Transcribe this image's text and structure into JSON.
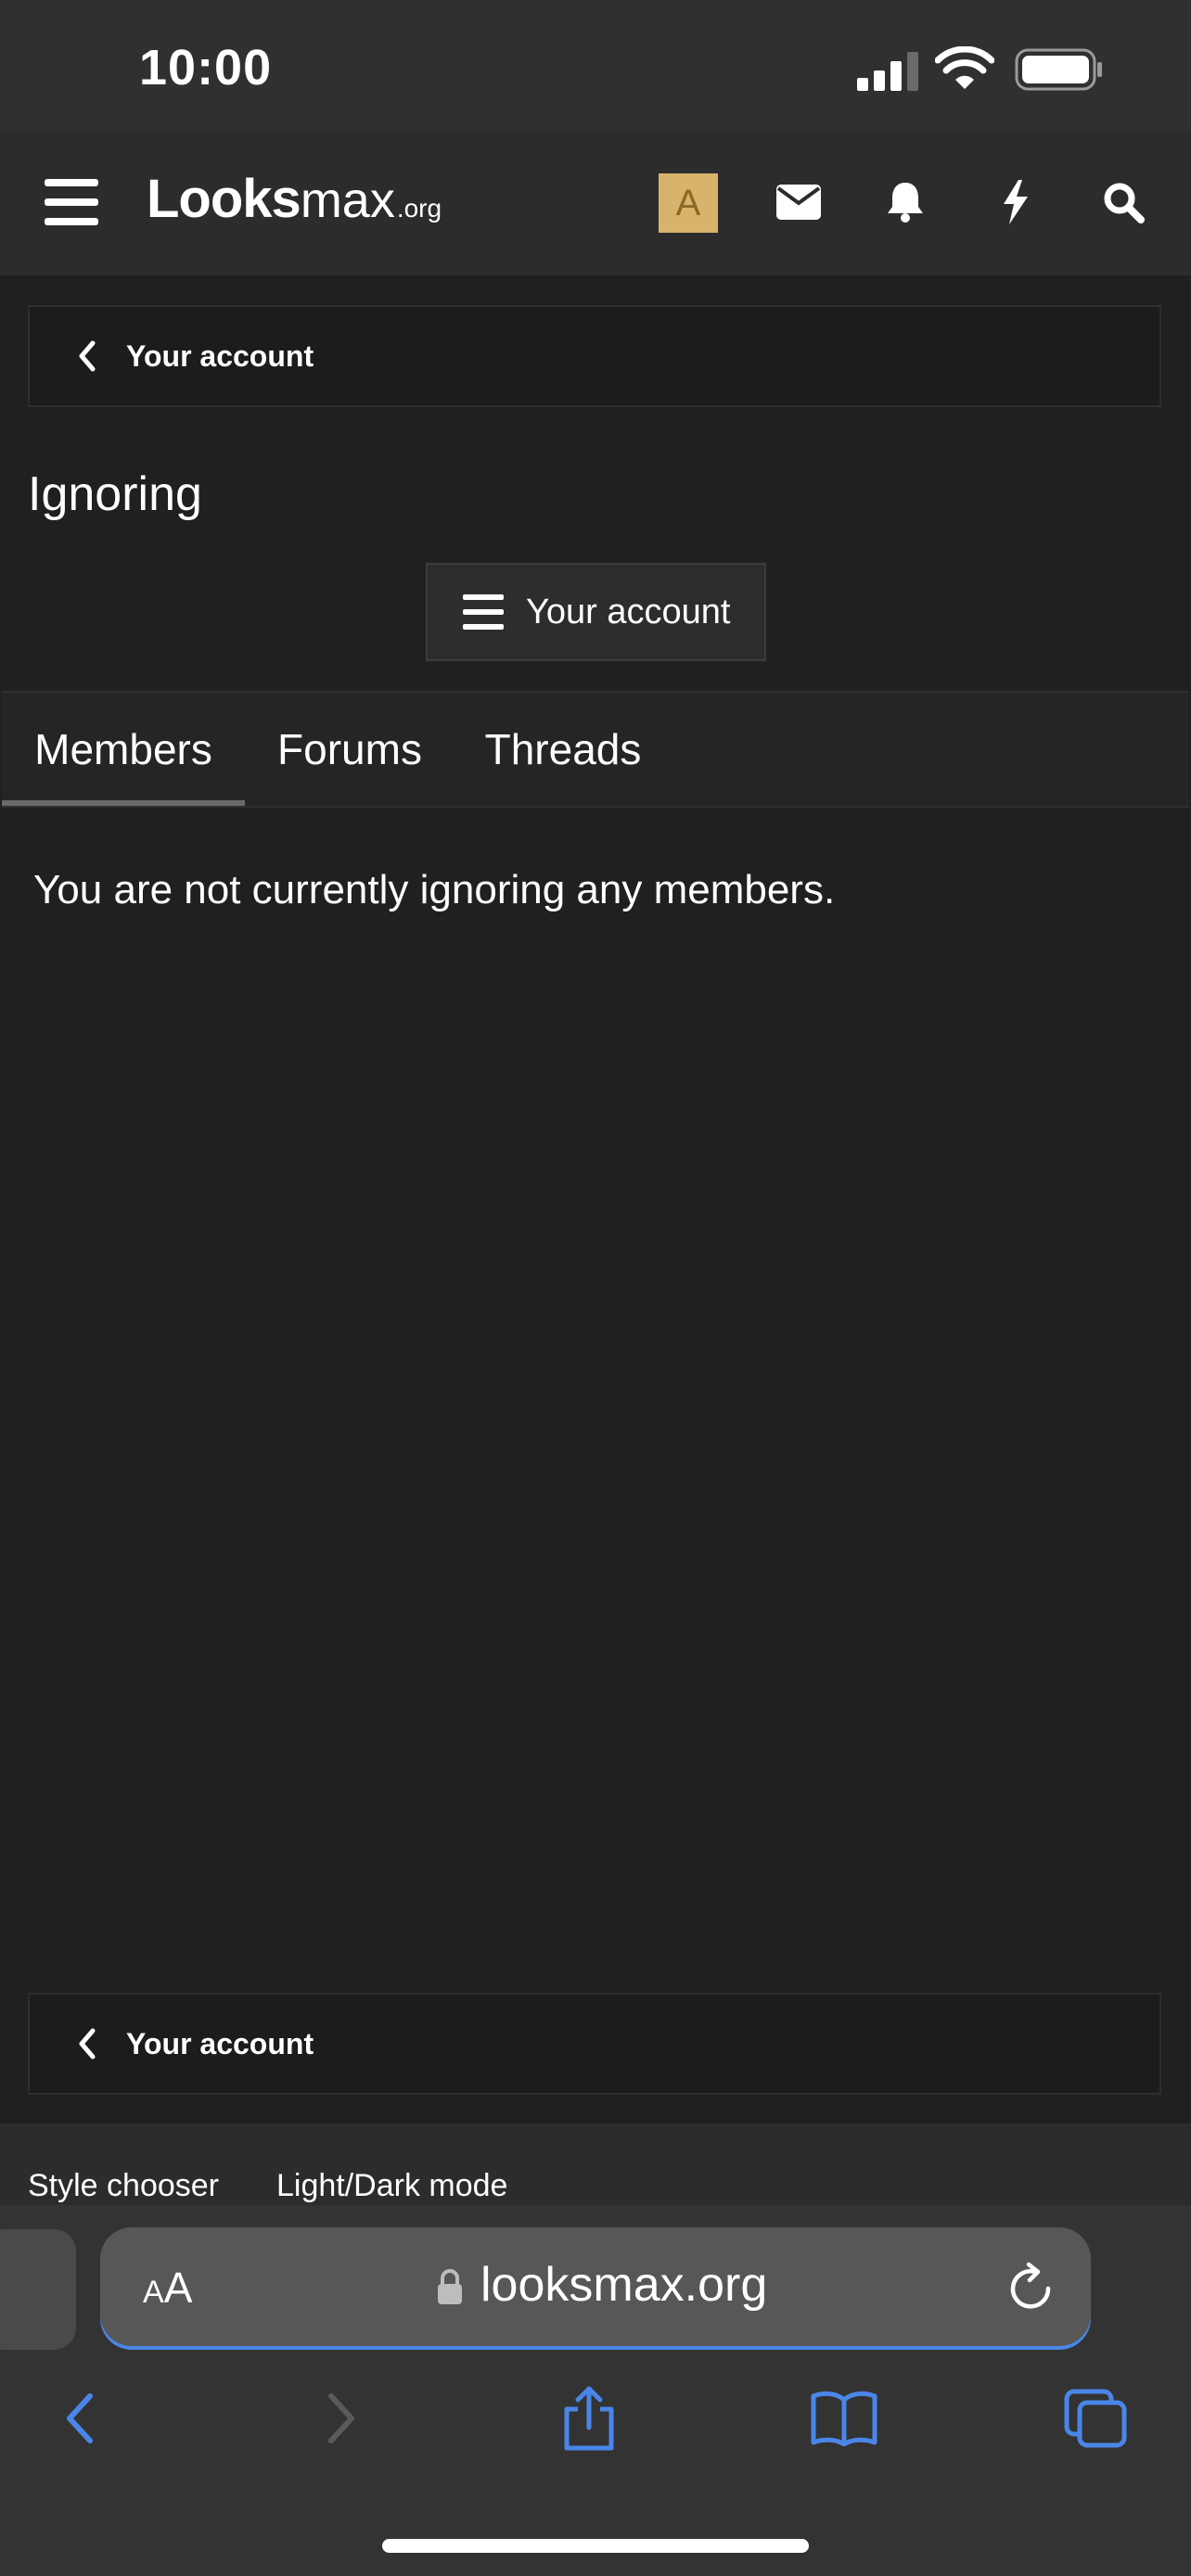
{
  "status_bar": {
    "time": "10:00"
  },
  "navbar": {
    "logo_main": "Looks",
    "logo_max": "max",
    "logo_tld": ".org",
    "avatar_letter": "A"
  },
  "breadcrumb": {
    "label": "Your account"
  },
  "page": {
    "title": "Ignoring",
    "account_menu_label": "Your account"
  },
  "tabs": [
    {
      "label": "Members",
      "active": true
    },
    {
      "label": "Forums",
      "active": false
    },
    {
      "label": "Threads",
      "active": false
    }
  ],
  "empty_message": "You are not currently ignoring any members.",
  "footer": {
    "style_chooser": "Style chooser",
    "light_dark_mode": "Light/Dark mode"
  },
  "browser": {
    "aa_label_small": "A",
    "aa_label_large": "A",
    "url": "looksmax.org"
  },
  "colors": {
    "background": "#202020",
    "accent_blue": "#4a86e8",
    "avatar_bg": "#d8b36b"
  }
}
